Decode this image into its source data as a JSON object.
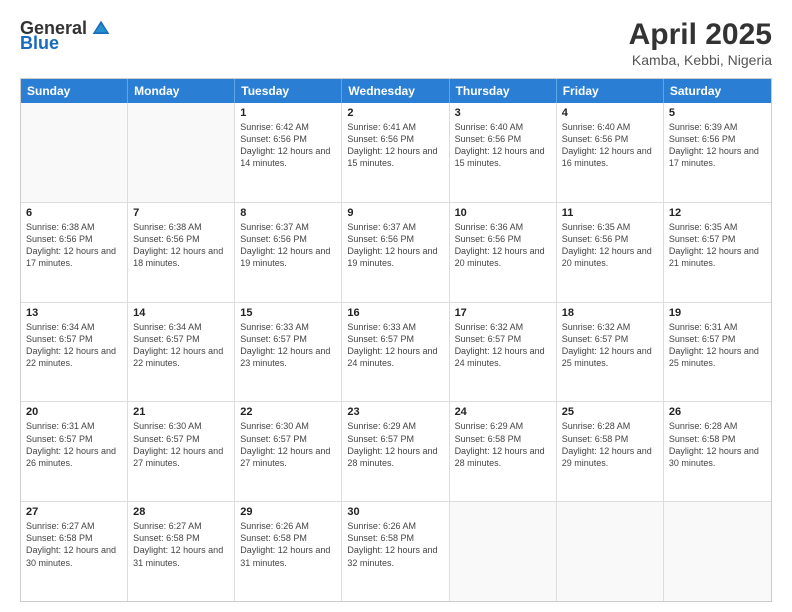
{
  "logo": {
    "general": "General",
    "blue": "Blue"
  },
  "title": "April 2025",
  "subtitle": "Kamba, Kebbi, Nigeria",
  "header_days": [
    "Sunday",
    "Monday",
    "Tuesday",
    "Wednesday",
    "Thursday",
    "Friday",
    "Saturday"
  ],
  "weeks": [
    [
      {
        "day": "",
        "info": ""
      },
      {
        "day": "",
        "info": ""
      },
      {
        "day": "1",
        "info": "Sunrise: 6:42 AM\nSunset: 6:56 PM\nDaylight: 12 hours and 14 minutes."
      },
      {
        "day": "2",
        "info": "Sunrise: 6:41 AM\nSunset: 6:56 PM\nDaylight: 12 hours and 15 minutes."
      },
      {
        "day": "3",
        "info": "Sunrise: 6:40 AM\nSunset: 6:56 PM\nDaylight: 12 hours and 15 minutes."
      },
      {
        "day": "4",
        "info": "Sunrise: 6:40 AM\nSunset: 6:56 PM\nDaylight: 12 hours and 16 minutes."
      },
      {
        "day": "5",
        "info": "Sunrise: 6:39 AM\nSunset: 6:56 PM\nDaylight: 12 hours and 17 minutes."
      }
    ],
    [
      {
        "day": "6",
        "info": "Sunrise: 6:38 AM\nSunset: 6:56 PM\nDaylight: 12 hours and 17 minutes."
      },
      {
        "day": "7",
        "info": "Sunrise: 6:38 AM\nSunset: 6:56 PM\nDaylight: 12 hours and 18 minutes."
      },
      {
        "day": "8",
        "info": "Sunrise: 6:37 AM\nSunset: 6:56 PM\nDaylight: 12 hours and 19 minutes."
      },
      {
        "day": "9",
        "info": "Sunrise: 6:37 AM\nSunset: 6:56 PM\nDaylight: 12 hours and 19 minutes."
      },
      {
        "day": "10",
        "info": "Sunrise: 6:36 AM\nSunset: 6:56 PM\nDaylight: 12 hours and 20 minutes."
      },
      {
        "day": "11",
        "info": "Sunrise: 6:35 AM\nSunset: 6:56 PM\nDaylight: 12 hours and 20 minutes."
      },
      {
        "day": "12",
        "info": "Sunrise: 6:35 AM\nSunset: 6:57 PM\nDaylight: 12 hours and 21 minutes."
      }
    ],
    [
      {
        "day": "13",
        "info": "Sunrise: 6:34 AM\nSunset: 6:57 PM\nDaylight: 12 hours and 22 minutes."
      },
      {
        "day": "14",
        "info": "Sunrise: 6:34 AM\nSunset: 6:57 PM\nDaylight: 12 hours and 22 minutes."
      },
      {
        "day": "15",
        "info": "Sunrise: 6:33 AM\nSunset: 6:57 PM\nDaylight: 12 hours and 23 minutes."
      },
      {
        "day": "16",
        "info": "Sunrise: 6:33 AM\nSunset: 6:57 PM\nDaylight: 12 hours and 24 minutes."
      },
      {
        "day": "17",
        "info": "Sunrise: 6:32 AM\nSunset: 6:57 PM\nDaylight: 12 hours and 24 minutes."
      },
      {
        "day": "18",
        "info": "Sunrise: 6:32 AM\nSunset: 6:57 PM\nDaylight: 12 hours and 25 minutes."
      },
      {
        "day": "19",
        "info": "Sunrise: 6:31 AM\nSunset: 6:57 PM\nDaylight: 12 hours and 25 minutes."
      }
    ],
    [
      {
        "day": "20",
        "info": "Sunrise: 6:31 AM\nSunset: 6:57 PM\nDaylight: 12 hours and 26 minutes."
      },
      {
        "day": "21",
        "info": "Sunrise: 6:30 AM\nSunset: 6:57 PM\nDaylight: 12 hours and 27 minutes."
      },
      {
        "day": "22",
        "info": "Sunrise: 6:30 AM\nSunset: 6:57 PM\nDaylight: 12 hours and 27 minutes."
      },
      {
        "day": "23",
        "info": "Sunrise: 6:29 AM\nSunset: 6:57 PM\nDaylight: 12 hours and 28 minutes."
      },
      {
        "day": "24",
        "info": "Sunrise: 6:29 AM\nSunset: 6:58 PM\nDaylight: 12 hours and 28 minutes."
      },
      {
        "day": "25",
        "info": "Sunrise: 6:28 AM\nSunset: 6:58 PM\nDaylight: 12 hours and 29 minutes."
      },
      {
        "day": "26",
        "info": "Sunrise: 6:28 AM\nSunset: 6:58 PM\nDaylight: 12 hours and 30 minutes."
      }
    ],
    [
      {
        "day": "27",
        "info": "Sunrise: 6:27 AM\nSunset: 6:58 PM\nDaylight: 12 hours and 30 minutes."
      },
      {
        "day": "28",
        "info": "Sunrise: 6:27 AM\nSunset: 6:58 PM\nDaylight: 12 hours and 31 minutes."
      },
      {
        "day": "29",
        "info": "Sunrise: 6:26 AM\nSunset: 6:58 PM\nDaylight: 12 hours and 31 minutes."
      },
      {
        "day": "30",
        "info": "Sunrise: 6:26 AM\nSunset: 6:58 PM\nDaylight: 12 hours and 32 minutes."
      },
      {
        "day": "",
        "info": ""
      },
      {
        "day": "",
        "info": ""
      },
      {
        "day": "",
        "info": ""
      }
    ]
  ]
}
